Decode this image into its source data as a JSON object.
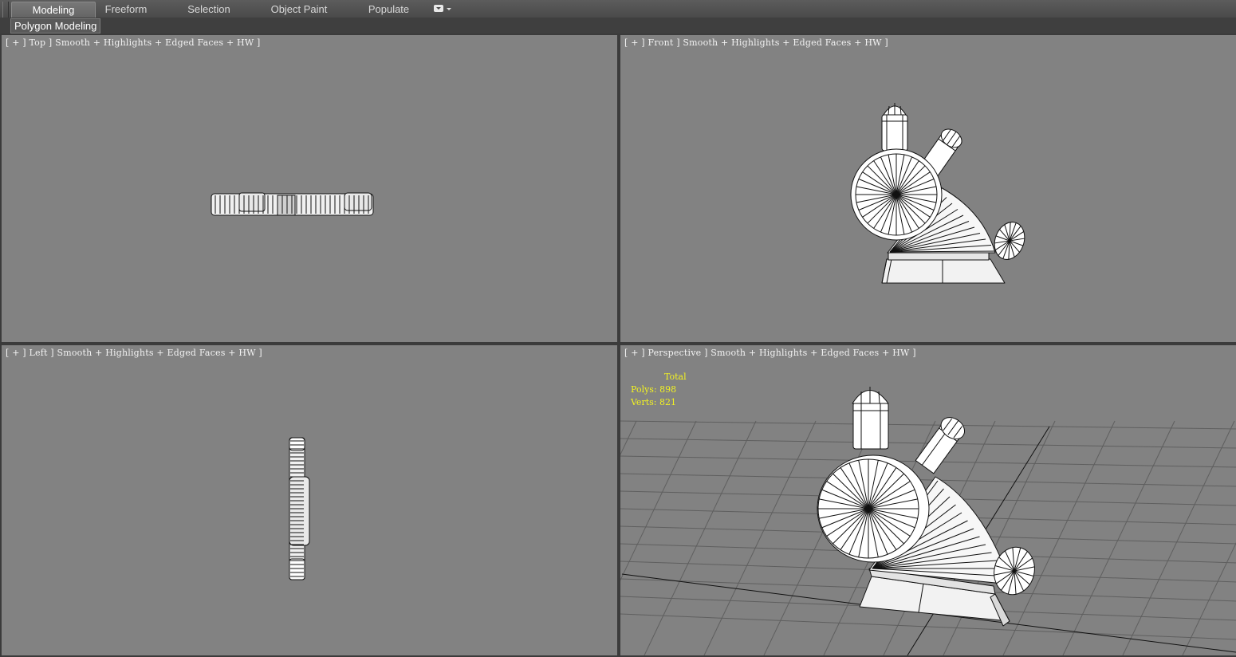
{
  "ribbon": {
    "tabs": [
      {
        "label": "Modeling",
        "active": true
      },
      {
        "label": "Freeform",
        "active": false
      },
      {
        "label": "Selection",
        "active": false
      },
      {
        "label": "Object Paint",
        "active": false
      },
      {
        "label": "Populate",
        "active": false
      }
    ],
    "overflow_icon": "dropdown-menu-icon",
    "panel_label": "Polygon Modeling"
  },
  "viewports": {
    "top": {
      "label": "[ + ] Top ] Smooth + Highlights + Edged Faces + HW ]"
    },
    "front": {
      "label": "[ + ] Front ] Smooth + Highlights + Edged Faces + HW ]"
    },
    "left": {
      "label": "[ + ] Left ] Smooth + Highlights + Edged Faces + HW ]"
    },
    "perspective": {
      "label": "[ + ] Perspective ] Smooth + Highlights + Edged Faces + HW ]"
    }
  },
  "stats": {
    "header": "Total",
    "polys_label": "Polys:",
    "polys_value": "898",
    "verts_label": "Verts:",
    "verts_value": "821"
  },
  "colors": {
    "viewport_bg": "#828282",
    "ui_bg": "#444444",
    "stats_text": "#f3f321",
    "wire": "#111111",
    "mesh_fill": "#ffffff"
  }
}
